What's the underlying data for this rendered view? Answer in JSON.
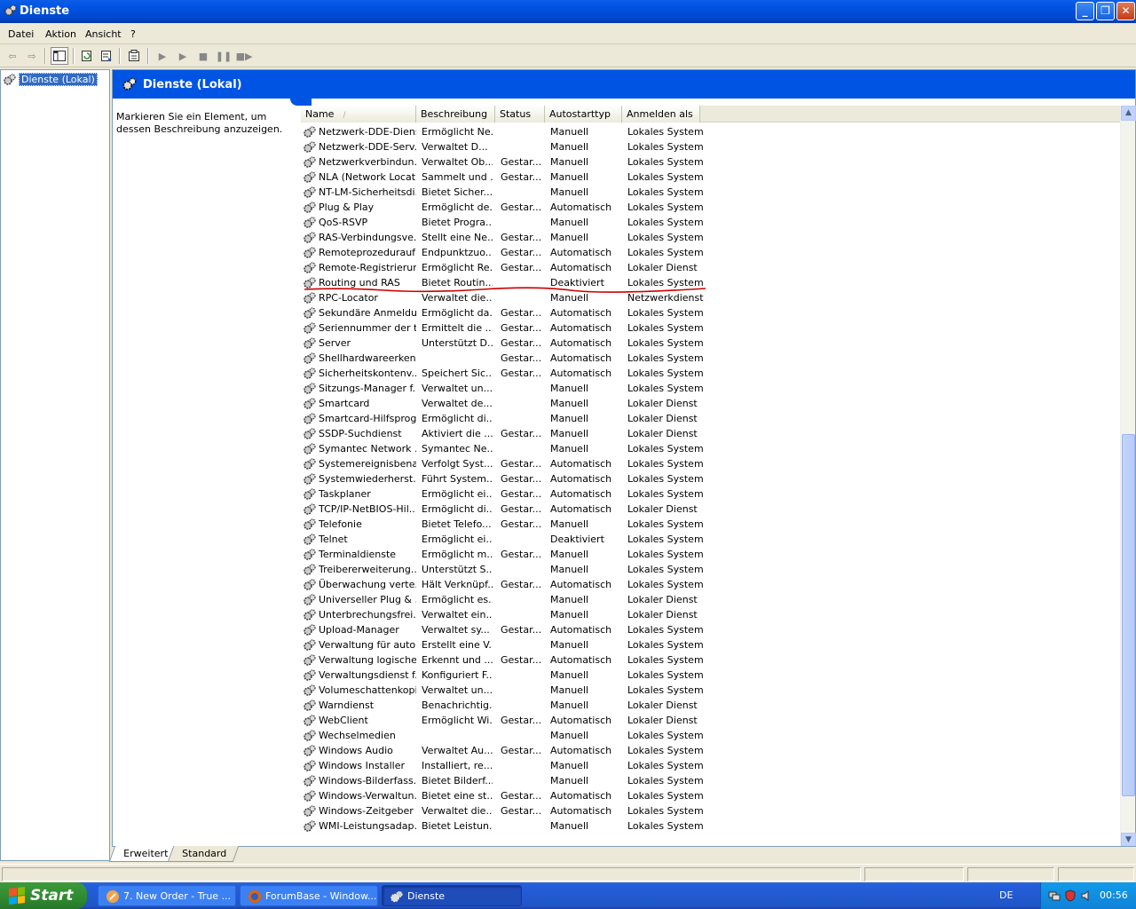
{
  "window": {
    "title": "Dienste",
    "buttons": {
      "minimize": "_",
      "restore": "❐",
      "close": "✕"
    }
  },
  "menu": [
    "Datei",
    "Aktion",
    "Ansicht",
    "?"
  ],
  "tree": {
    "selected": "Dienste (Lokal)"
  },
  "banner": {
    "title": "Dienste (Lokal)"
  },
  "description_hint": "Markieren Sie ein Element, um dessen Beschreibung anzuzeigen.",
  "columns": {
    "name": "Name",
    "description": "Beschreibung",
    "status": "Status",
    "startup": "Autostarttyp",
    "logon": "Anmelden als"
  },
  "services": [
    [
      "Netzwerk-DDE-Dienst",
      "Ermöglicht Ne...",
      "",
      "Manuell",
      "Lokales System"
    ],
    [
      "Netzwerk-DDE-Serv...",
      "Verwaltet D...",
      "",
      "Manuell",
      "Lokales System"
    ],
    [
      "Netzwerkverbindun...",
      "Verwaltet Ob...",
      "Gestar...",
      "Manuell",
      "Lokales System"
    ],
    [
      "NLA (Network Locat...",
      "Sammelt und ...",
      "Gestar...",
      "Manuell",
      "Lokales System"
    ],
    [
      "NT-LM-Sicherheitsdi...",
      "Bietet Sicher...",
      "",
      "Manuell",
      "Lokales System"
    ],
    [
      "Plug & Play",
      "Ermöglicht de...",
      "Gestar...",
      "Automatisch",
      "Lokales System"
    ],
    [
      "QoS-RSVP",
      "Bietet Progra...",
      "",
      "Manuell",
      "Lokales System"
    ],
    [
      "RAS-Verbindungsve...",
      "Stellt eine Ne...",
      "Gestar...",
      "Manuell",
      "Lokales System"
    ],
    [
      "Remoteprozeduraufr...",
      "Endpunktzuo...",
      "Gestar...",
      "Automatisch",
      "Lokales System"
    ],
    [
      "Remote-Registrierung",
      "Ermöglicht Re...",
      "Gestar...",
      "Automatisch",
      "Lokaler Dienst"
    ],
    [
      "Routing und RAS",
      "Bietet Routin...",
      "",
      "Deaktiviert",
      "Lokales System"
    ],
    [
      "RPC-Locator",
      "Verwaltet die...",
      "",
      "Manuell",
      "Netzwerkdienst"
    ],
    [
      "Sekundäre Anmeldung",
      "Ermöglicht da...",
      "Gestar...",
      "Automatisch",
      "Lokales System"
    ],
    [
      "Seriennummer der t...",
      "Ermittelt die ...",
      "Gestar...",
      "Automatisch",
      "Lokales System"
    ],
    [
      "Server",
      "Unterstützt D...",
      "Gestar...",
      "Automatisch",
      "Lokales System"
    ],
    [
      "Shellhardwareerken...",
      "",
      "Gestar...",
      "Automatisch",
      "Lokales System"
    ],
    [
      "Sicherheitskontenv...",
      "Speichert Sic...",
      "Gestar...",
      "Automatisch",
      "Lokales System"
    ],
    [
      "Sitzungs-Manager f...",
      "Verwaltet un...",
      "",
      "Manuell",
      "Lokales System"
    ],
    [
      "Smartcard",
      "Verwaltet de...",
      "",
      "Manuell",
      "Lokaler Dienst"
    ],
    [
      "Smartcard-Hilfsprog...",
      "Ermöglicht di...",
      "",
      "Manuell",
      "Lokaler Dienst"
    ],
    [
      "SSDP-Suchdienst",
      "Aktiviert die ...",
      "Gestar...",
      "Manuell",
      "Lokaler Dienst"
    ],
    [
      "Symantec Network ...",
      "Symantec Ne...",
      "",
      "Manuell",
      "Lokales System"
    ],
    [
      "Systemereignisbena...",
      "Verfolgt Syst...",
      "Gestar...",
      "Automatisch",
      "Lokales System"
    ],
    [
      "Systemwiederherst...",
      "Führt System...",
      "Gestar...",
      "Automatisch",
      "Lokales System"
    ],
    [
      "Taskplaner",
      "Ermöglicht ei...",
      "Gestar...",
      "Automatisch",
      "Lokales System"
    ],
    [
      "TCP/IP-NetBIOS-Hil...",
      "Ermöglicht di...",
      "Gestar...",
      "Automatisch",
      "Lokaler Dienst"
    ],
    [
      "Telefonie",
      "Bietet Telefo...",
      "Gestar...",
      "Manuell",
      "Lokales System"
    ],
    [
      "Telnet",
      "Ermöglicht ei...",
      "",
      "Deaktiviert",
      "Lokales System"
    ],
    [
      "Terminaldienste",
      "Ermöglicht m...",
      "Gestar...",
      "Manuell",
      "Lokales System"
    ],
    [
      "Treibererweiterung...",
      "Unterstützt S...",
      "",
      "Manuell",
      "Lokales System"
    ],
    [
      "Überwachung verte...",
      "Hält Verknüpf...",
      "Gestar...",
      "Automatisch",
      "Lokales System"
    ],
    [
      "Universeller Plug & ...",
      "Ermöglicht es...",
      "",
      "Manuell",
      "Lokaler Dienst"
    ],
    [
      "Unterbrechungsfrei...",
      "Verwaltet ein...",
      "",
      "Manuell",
      "Lokaler Dienst"
    ],
    [
      "Upload-Manager",
      "Verwaltet sy...",
      "Gestar...",
      "Automatisch",
      "Lokales System"
    ],
    [
      "Verwaltung für auto...",
      "Erstellt eine V...",
      "",
      "Manuell",
      "Lokales System"
    ],
    [
      "Verwaltung logische...",
      "Erkennt und ...",
      "Gestar...",
      "Automatisch",
      "Lokales System"
    ],
    [
      "Verwaltungsdienst f...",
      "Konfiguriert F...",
      "",
      "Manuell",
      "Lokales System"
    ],
    [
      "Volumeschattenkopie",
      "Verwaltet un...",
      "",
      "Manuell",
      "Lokales System"
    ],
    [
      "Warndienst",
      "Benachrichtig...",
      "",
      "Manuell",
      "Lokaler Dienst"
    ],
    [
      "WebClient",
      "Ermöglicht Wi...",
      "Gestar...",
      "Automatisch",
      "Lokaler Dienst"
    ],
    [
      "Wechselmedien",
      "",
      "",
      "Manuell",
      "Lokales System"
    ],
    [
      "Windows Audio",
      "Verwaltet Au...",
      "Gestar...",
      "Automatisch",
      "Lokales System"
    ],
    [
      "Windows Installer",
      "Installiert, re...",
      "",
      "Manuell",
      "Lokales System"
    ],
    [
      "Windows-Bilderfass...",
      "Bietet Bilderf...",
      "",
      "Manuell",
      "Lokales System"
    ],
    [
      "Windows-Verwaltun...",
      "Bietet eine st...",
      "Gestar...",
      "Automatisch",
      "Lokales System"
    ],
    [
      "Windows-Zeitgeber",
      "Verwaltet die...",
      "Gestar...",
      "Automatisch",
      "Lokales System"
    ],
    [
      "WMI-Leistungsadap...",
      "Bietet Leistun...",
      "",
      "Manuell",
      "Lokales System"
    ]
  ],
  "tabs": [
    "Erweitert",
    "Standard"
  ],
  "taskbar": {
    "start": "Start",
    "tasks": [
      "7. New Order - True ...",
      "ForumBase - Window...",
      "Dienste"
    ],
    "language": "DE",
    "clock": "00:56"
  },
  "annotation": {
    "color": "#cc0000",
    "row": "Routing und RAS"
  }
}
